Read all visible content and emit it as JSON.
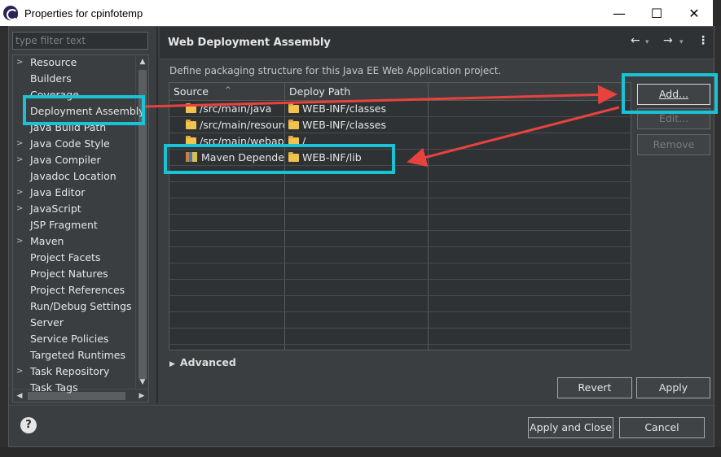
{
  "window": {
    "title": "Properties for cpinfotemp",
    "minimize_glyph": "—",
    "maximize_glyph": "☐",
    "close_glyph": "✕"
  },
  "sidebar": {
    "filter_placeholder": "type filter text",
    "items": [
      {
        "label": "Resource",
        "expandable": true
      },
      {
        "label": "Builders",
        "expandable": false
      },
      {
        "label": "Coverage",
        "expandable": false
      },
      {
        "label": "Deployment Assembly",
        "expandable": false,
        "selected": true
      },
      {
        "label": "Java Build Path",
        "expandable": false
      },
      {
        "label": "Java Code Style",
        "expandable": true
      },
      {
        "label": "Java Compiler",
        "expandable": true
      },
      {
        "label": "Javadoc Location",
        "expandable": false
      },
      {
        "label": "Java Editor",
        "expandable": true
      },
      {
        "label": "JavaScript",
        "expandable": true
      },
      {
        "label": "JSP Fragment",
        "expandable": false
      },
      {
        "label": "Maven",
        "expandable": true
      },
      {
        "label": "Project Facets",
        "expandable": false
      },
      {
        "label": "Project Natures",
        "expandable": false
      },
      {
        "label": "Project References",
        "expandable": false
      },
      {
        "label": "Run/Debug Settings",
        "expandable": false
      },
      {
        "label": "Server",
        "expandable": false
      },
      {
        "label": "Service Policies",
        "expandable": false
      },
      {
        "label": "Targeted Runtimes",
        "expandable": false
      },
      {
        "label": "Task Repository",
        "expandable": true
      },
      {
        "label": "Task Tags",
        "expandable": false
      }
    ]
  },
  "page": {
    "title": "Web Deployment Assembly",
    "description": "Define packaging structure for this Java EE Web Application project.",
    "nav_back": "←",
    "nav_forward": "→",
    "menu": "⋮"
  },
  "table": {
    "columns": [
      "Source",
      "Deploy Path"
    ],
    "rows": [
      {
        "source": "/src/main/java",
        "deploy": "WEB-INF/classes",
        "icon": "folder-icon"
      },
      {
        "source": "/src/main/resources",
        "deploy": "WEB-INF/classes",
        "icon": "folder-icon"
      },
      {
        "source": "/src/main/webapp",
        "deploy": "/",
        "icon": "folder-icon"
      },
      {
        "source": "Maven Dependencies",
        "deploy": "WEB-INF/lib",
        "icon": "library-icon"
      }
    ]
  },
  "buttons": {
    "add": "Add...",
    "edit": "Edit...",
    "remove": "Remove",
    "revert": "Revert",
    "apply": "Apply",
    "apply_close": "Apply and Close",
    "cancel": "Cancel"
  },
  "advanced_label": "Advanced",
  "help": "?",
  "annotation_color": "#19c3d6",
  "arrow_color": "#e8423e"
}
